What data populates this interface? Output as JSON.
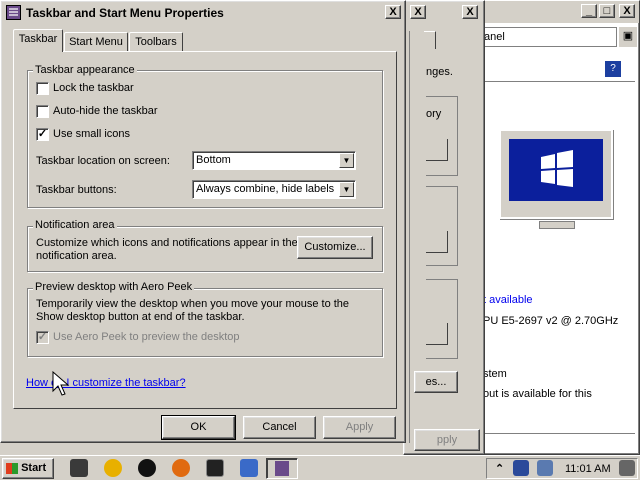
{
  "dialog": {
    "title": "Taskbar and Start Menu Properties",
    "tabs": [
      "Taskbar",
      "Start Menu",
      "Toolbars"
    ],
    "appearance_group": "Taskbar appearance",
    "lock_taskbar": "Lock the taskbar",
    "autohide": "Auto-hide the taskbar",
    "small_icons": "Use small icons",
    "location_label": "Taskbar location on screen:",
    "location_value": "Bottom",
    "buttons_label": "Taskbar buttons:",
    "buttons_value": "Always combine, hide labels",
    "notif_group": "Notification area",
    "notif_text": "Customize which icons and notifications appear in the notification area.",
    "customize_btn": "Customize...",
    "peek_group": "Preview desktop with Aero Peek",
    "peek_text": "Temporarily view the desktop when you move your mouse to the Show desktop button at end of the taskbar.",
    "peek_check": "Use Aero Peek to preview the desktop",
    "help_link": "How do I customize the taskbar?",
    "ok": "OK",
    "cancel": "Cancel",
    "apply": "Apply",
    "close_glyph": "X"
  },
  "middle_window": {
    "text_nges": "nges.",
    "text_ory": "ory",
    "text_es": "es...",
    "apply": "pply"
  },
  "back_window": {
    "address": "anel",
    "text_available": "t available",
    "text_cpu": "PU E5-2697 v2 @ 2.70GHz",
    "text_stem": "stem",
    "text_out": "out is available for this"
  },
  "taskbar": {
    "start": "Start",
    "time": "11:01 AM"
  },
  "colors": {
    "face": "#d4d0c8",
    "monitor_blue": "#0b1f9c",
    "link": "#0000ee"
  }
}
